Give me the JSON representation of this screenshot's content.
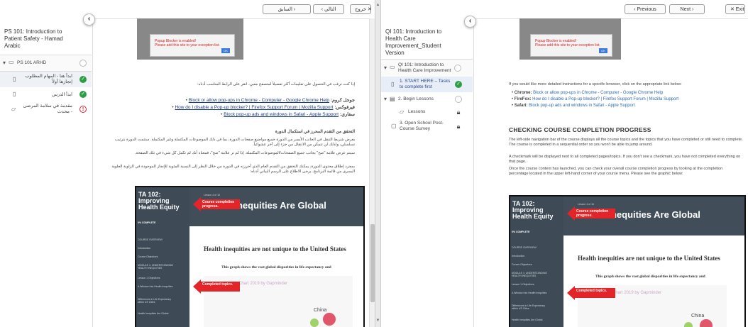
{
  "left": {
    "topbar": {
      "prev_label": "السابق ›",
      "next_label": "‹ التالي",
      "exit_label": "خروج ✕"
    },
    "sidebar": {
      "course_title": "PS 101: Introduction to Patient Safety - Hamad Arabic",
      "section_label": "PS 101 ARHD",
      "items": [
        {
          "label": "ابدأ هنا - المهام المطلوب إنجازها أولاً",
          "status": "done"
        },
        {
          "label": "ابدأ الدرس",
          "status": "done"
        },
        {
          "label": "مقدمة في سلامة المرضى - محدث",
          "status": "alert"
        }
      ]
    },
    "popup": {
      "message": "Popup Blocker is enabled!\nPlease add this site to your exception list.",
      "ok": "OK"
    },
    "intro": "إذا كنت ترغب في الحصول على تعليمات أكثر تفصيلاً لمتصفح معين، انقر على الرابط المناسب أدناه:",
    "links": [
      {
        "prefix": "جوجل كروم: ",
        "text": "Block or allow pop-ups in Chrome - Computer - Google Chrome Help"
      },
      {
        "prefix": "فيرفوكس: ",
        "text": "How do I disable a Pop-up blocker? | Firefox Support Forum | Mozilla Support"
      },
      {
        "prefix": "سفاري: ",
        "text": "Block pop-up ads and windows in Safari - Apple Support"
      }
    ],
    "heading": "التحقق من التقدم المحرز في استكمال الدورة",
    "paragraphs": [
      "يعرض شريط التنقل في الجانب الأيسر من الدورة جميع مواضيع صفحات الدورة، بما في ذلك الموضوعات المكتملة وغير المكتملة. ستتمت الدورة بترتيب تسلسلي، ولذلك لن تتمكن من الانتقال من جزء إلى آخر عشوائياً.",
      "سيتم عرض علامة \"صح\" بجانب جميع الصفحات/الموضوعات المكتملة. إذا لم تر علامة \"صح\"، فمعناه أنك لم تكمل كل شيء في تلك الصفحة.",
      "بمجرد إطلاق محتوى الدورة، يمكنك التحقق من التقدم العام الذي أحرزته في الدورة من خلال النظر إلى النسبة المئوية للإنجاز الموجودة في الزاوية العلوية اليسرى من قائمة البرنامج. يرجى الاطلاع على الرسم البياني أدناه:"
    ]
  },
  "right": {
    "topbar": {
      "prev_label": "‹ Previous",
      "next_label": "Next ›",
      "exit_label": "✕ Exit"
    },
    "sidebar": {
      "course_title": "QI 101: Introduction to Health Care Improvement_Student Version",
      "section_label": "QI 101: Introduction to Health Care Improvement",
      "items": [
        {
          "label": "1. START HERE – Tasks to complete first",
          "status": "done",
          "icon": "page"
        },
        {
          "label": "2. Begin Lessons",
          "status": "todo",
          "icon": "group"
        },
        {
          "label": "Lessons",
          "status": "lock",
          "icon": "stack"
        },
        {
          "label": "3. Open School Post-Course Survey",
          "status": "lock",
          "icon": "survey"
        }
      ]
    },
    "popup": {
      "message": "Popup Blocker is enabled!\nPlease add this site to your exception list.",
      "ok": "OK"
    },
    "intro": "If you would like more detailed instructions for a specific browser, click on the appropriate link below:",
    "links": [
      {
        "prefix": "Chrome: ",
        "text": "Block or allow pop-ups in Chrome - Computer - Google Chrome Help"
      },
      {
        "prefix": "FireFox: ",
        "text": "How do I disable a Pop-up blocker? | Firefox Support Forum | Mozilla Support"
      },
      {
        "prefix": "Safari: ",
        "text": "Block pop-up ads and windows in Safari - Apple Support"
      }
    ],
    "heading": "CHECKING COURSE COMPLETION PROGRESS",
    "paragraphs": [
      "The left-side navigation bar of the course displays all the course topics and the topics that you have completed or still need to complete. The course is completed in a sequential order so you won't be able to jump around.",
      "A checkmark will be displayed next to all completed pages/topics. If you don't see a checkmark, you have not completed everything on that page.",
      "Once the course content has launched, you can check your overall course completion progress by looking at the completion percentage located in the upper left-hand corner of your course menu. Please see the graphic below:"
    ]
  },
  "example": {
    "course_title": "TA 102: Improving Health Equity",
    "progress_label": "0% COMPLETE",
    "menu": [
      "COURSE OVERVIEW",
      "Introduction",
      "Course Objectives",
      "MODULE 1: UNDERSTANDING HEALTH INEQUITIES",
      "Lesson 1 Objectives",
      "A Window Into Health Inequities",
      "Differences in Life Expectancy within US Cities",
      "Health Inequities Are Global"
    ],
    "lesson_label": "Lesson 4 of 16",
    "header_title": "Health Inequities Are Global",
    "subheading": "Health inequities are not unique to the United States",
    "caption": "This graph shows the vast global disparities in life expectancy and",
    "chart_title": "Health Chart 2019 by Gapminder",
    "callout_progress": "Course completion progress.",
    "callout_topics": "Completed topics.",
    "country_label": "China"
  }
}
